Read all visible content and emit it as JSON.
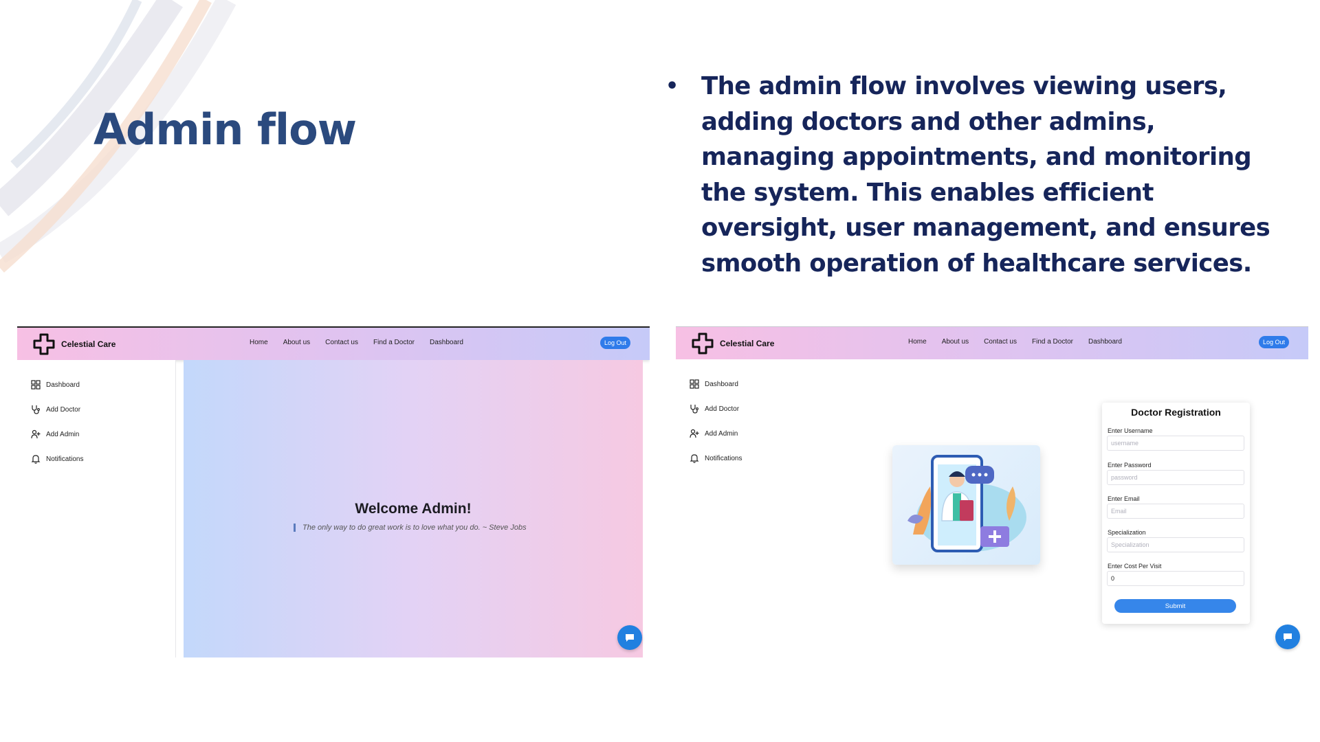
{
  "slide": {
    "title": "Admin flow",
    "bullet": "The admin flow involves viewing users, adding doctors and other admins, managing appointments, and monitoring the system. This enables efficient oversight, user management, and ensures smooth operation of healthcare services."
  },
  "app": {
    "brand": "Celestial Care",
    "nav": [
      "Home",
      "About us",
      "Contact us",
      "Find a Doctor",
      "Dashboard"
    ],
    "logout_label": "Log Out",
    "sidebar": [
      {
        "label": "Dashboard",
        "icon": "grid-icon"
      },
      {
        "label": "Add Doctor",
        "icon": "stethoscope-icon"
      },
      {
        "label": "Add Admin",
        "icon": "user-plus-icon"
      },
      {
        "label": "Notifications",
        "icon": "bell-icon"
      }
    ]
  },
  "dashboard": {
    "welcome": "Welcome Admin!",
    "quote": "The only way to do great work is to love what you do. ~ Steve Jobs"
  },
  "doctor_form": {
    "title": "Doctor Registration",
    "fields": [
      {
        "label": "Enter Username",
        "placeholder": "username",
        "value": ""
      },
      {
        "label": "Enter Password",
        "placeholder": "password",
        "value": ""
      },
      {
        "label": "Enter Email",
        "placeholder": "Email",
        "value": ""
      },
      {
        "label": "Specialization",
        "placeholder": "Specialization",
        "value": ""
      },
      {
        "label": "Enter Cost Per Visit",
        "placeholder": "",
        "value": "0"
      }
    ],
    "submit_label": "Submit"
  },
  "colors": {
    "title": "#2b4a7e",
    "bullet_text": "#16255a",
    "accent": "#2f7bea",
    "chat": "#2180e0"
  }
}
